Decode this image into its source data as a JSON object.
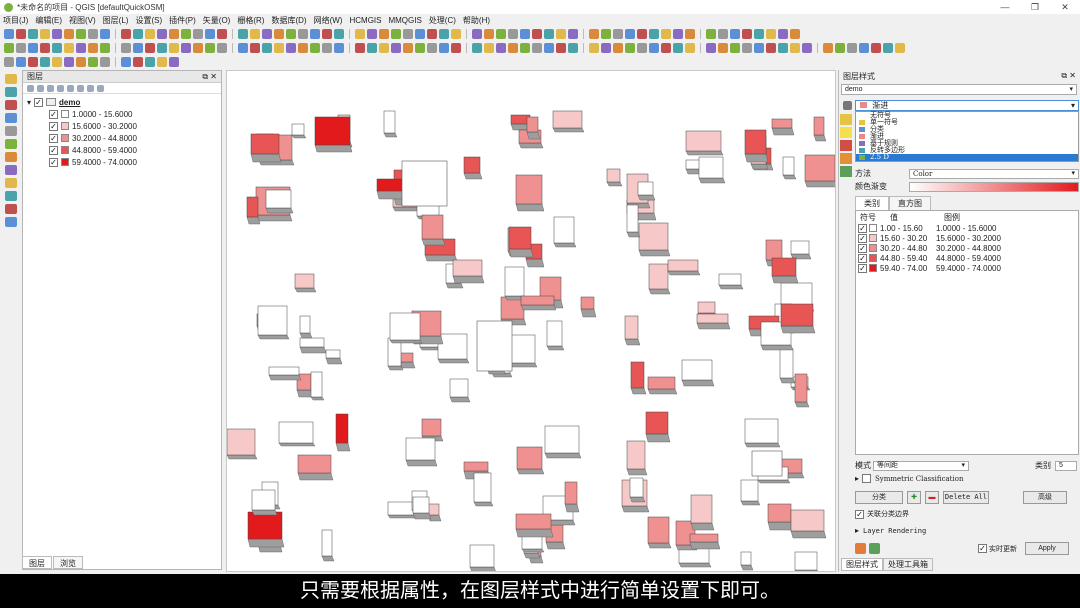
{
  "window": {
    "title": "*未命名的项目 - QGIS [defaultQuickOSM]",
    "controls": [
      "—",
      "❐",
      "✕"
    ]
  },
  "menu": [
    "项目(J)",
    "编辑(E)",
    "视图(V)",
    "图层(L)",
    "设置(S)",
    "插件(P)",
    "矢量(O)",
    "栅格(R)",
    "数据库(D)",
    "网络(W)",
    "HCMGIS",
    "MMQGIS",
    "处理(C)",
    "帮助(H)"
  ],
  "layers_panel": {
    "title": "图层",
    "layer_name": "demo",
    "classes": [
      {
        "label": "1.0000 - 15.6000",
        "color": "#ffffff"
      },
      {
        "label": "15.6000 - 30.2000",
        "color": "#f6c8c8"
      },
      {
        "label": "30.2000 - 44.8000",
        "color": "#ef9191"
      },
      {
        "label": "44.8000 - 59.4000",
        "color": "#e85555"
      },
      {
        "label": "59.4000 - 74.0000",
        "color": "#e31a1c"
      }
    ],
    "bottom_tabs": [
      "图层",
      "浏览"
    ]
  },
  "style_panel": {
    "title": "图层样式",
    "layer_select": "demo",
    "renderer_current": "渐进",
    "renderer_options": [
      "无符号",
      "单一符号",
      "分类",
      "渐进",
      "基于规则",
      "反转多边形",
      "2.5 D"
    ],
    "renderer_selected_index": 6,
    "method_label": "方法",
    "method_value": "Color",
    "color_ramp_label": "颜色渐变",
    "tabs": [
      "类别",
      "直方图"
    ],
    "columns": [
      "符号",
      "值",
      "图例"
    ],
    "rows": [
      {
        "value": "1.00 - 15.60",
        "legend": "1.0000 - 15.6000",
        "color": "#ffffff"
      },
      {
        "value": "15.60 - 30.20",
        "legend": "15.6000 - 30.2000",
        "color": "#f6c8c8"
      },
      {
        "value": "30.20 - 44.80",
        "legend": "30.2000 - 44.8000",
        "color": "#ef9191"
      },
      {
        "value": "44.80 - 59.40",
        "legend": "44.8000 - 59.4000",
        "color": "#e85555"
      },
      {
        "value": "59.40 - 74.00",
        "legend": "59.4000 - 74.0000",
        "color": "#e31a1c"
      }
    ],
    "mode_label": "模式",
    "mode_value": "等间距",
    "classes_label": "类别",
    "classes_count": "5",
    "symmetric_label": "Symmetric Classification",
    "classify_button": "分类",
    "delete_all_button": "Delete All",
    "advanced_button": "高级",
    "link_borders_label": "关联分类边界",
    "layer_rendering_label": "Layer Rendering",
    "live_update_label": "实时更新",
    "apply_button": "Apply",
    "footer_tabs": [
      "图层样式",
      "处理工具箱"
    ]
  },
  "subtitle": "只需要根据属性，在图层样式中进行简单设置下即可。"
}
